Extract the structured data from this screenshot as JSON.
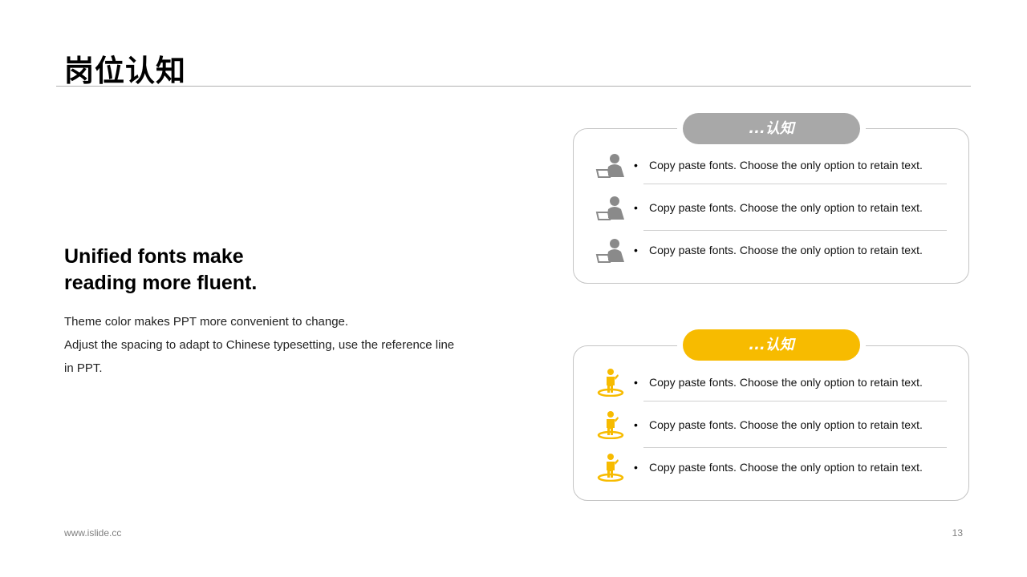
{
  "page": {
    "title": "岗位认知",
    "heading_lines": [
      "Unified fonts make",
      "reading more fluent."
    ],
    "body_lines": [
      "Theme color makes PPT more convenient to change.",
      "Adjust the spacing to adapt to Chinese typesetting, use the reference line",
      "in PPT."
    ],
    "footer_url": "www.islide.cc",
    "page_number": "13"
  },
  "colors": {
    "accent": "#f7bb00",
    "gray": "#a8a8a8",
    "rule": "#b0b0b0"
  },
  "panels": [
    {
      "label": "...认知",
      "icon": "person-at-laptop-icon",
      "items": [
        {
          "bullet": "•",
          "text": "Copy paste fonts. Choose the only option to retain text."
        },
        {
          "bullet": "•",
          "text": "Copy paste fonts. Choose the only option to retain text."
        },
        {
          "bullet": "•",
          "text": "Copy paste fonts. Choose the only option to retain text."
        }
      ]
    },
    {
      "label": "...认知",
      "icon": "standing-person-icon",
      "items": [
        {
          "bullet": "•",
          "text": "Copy paste fonts. Choose the only option to retain text."
        },
        {
          "bullet": "•",
          "text": "Copy paste fonts. Choose the only option to retain text."
        },
        {
          "bullet": "•",
          "text": "Copy paste fonts. Choose the only option to retain text."
        }
      ]
    }
  ]
}
